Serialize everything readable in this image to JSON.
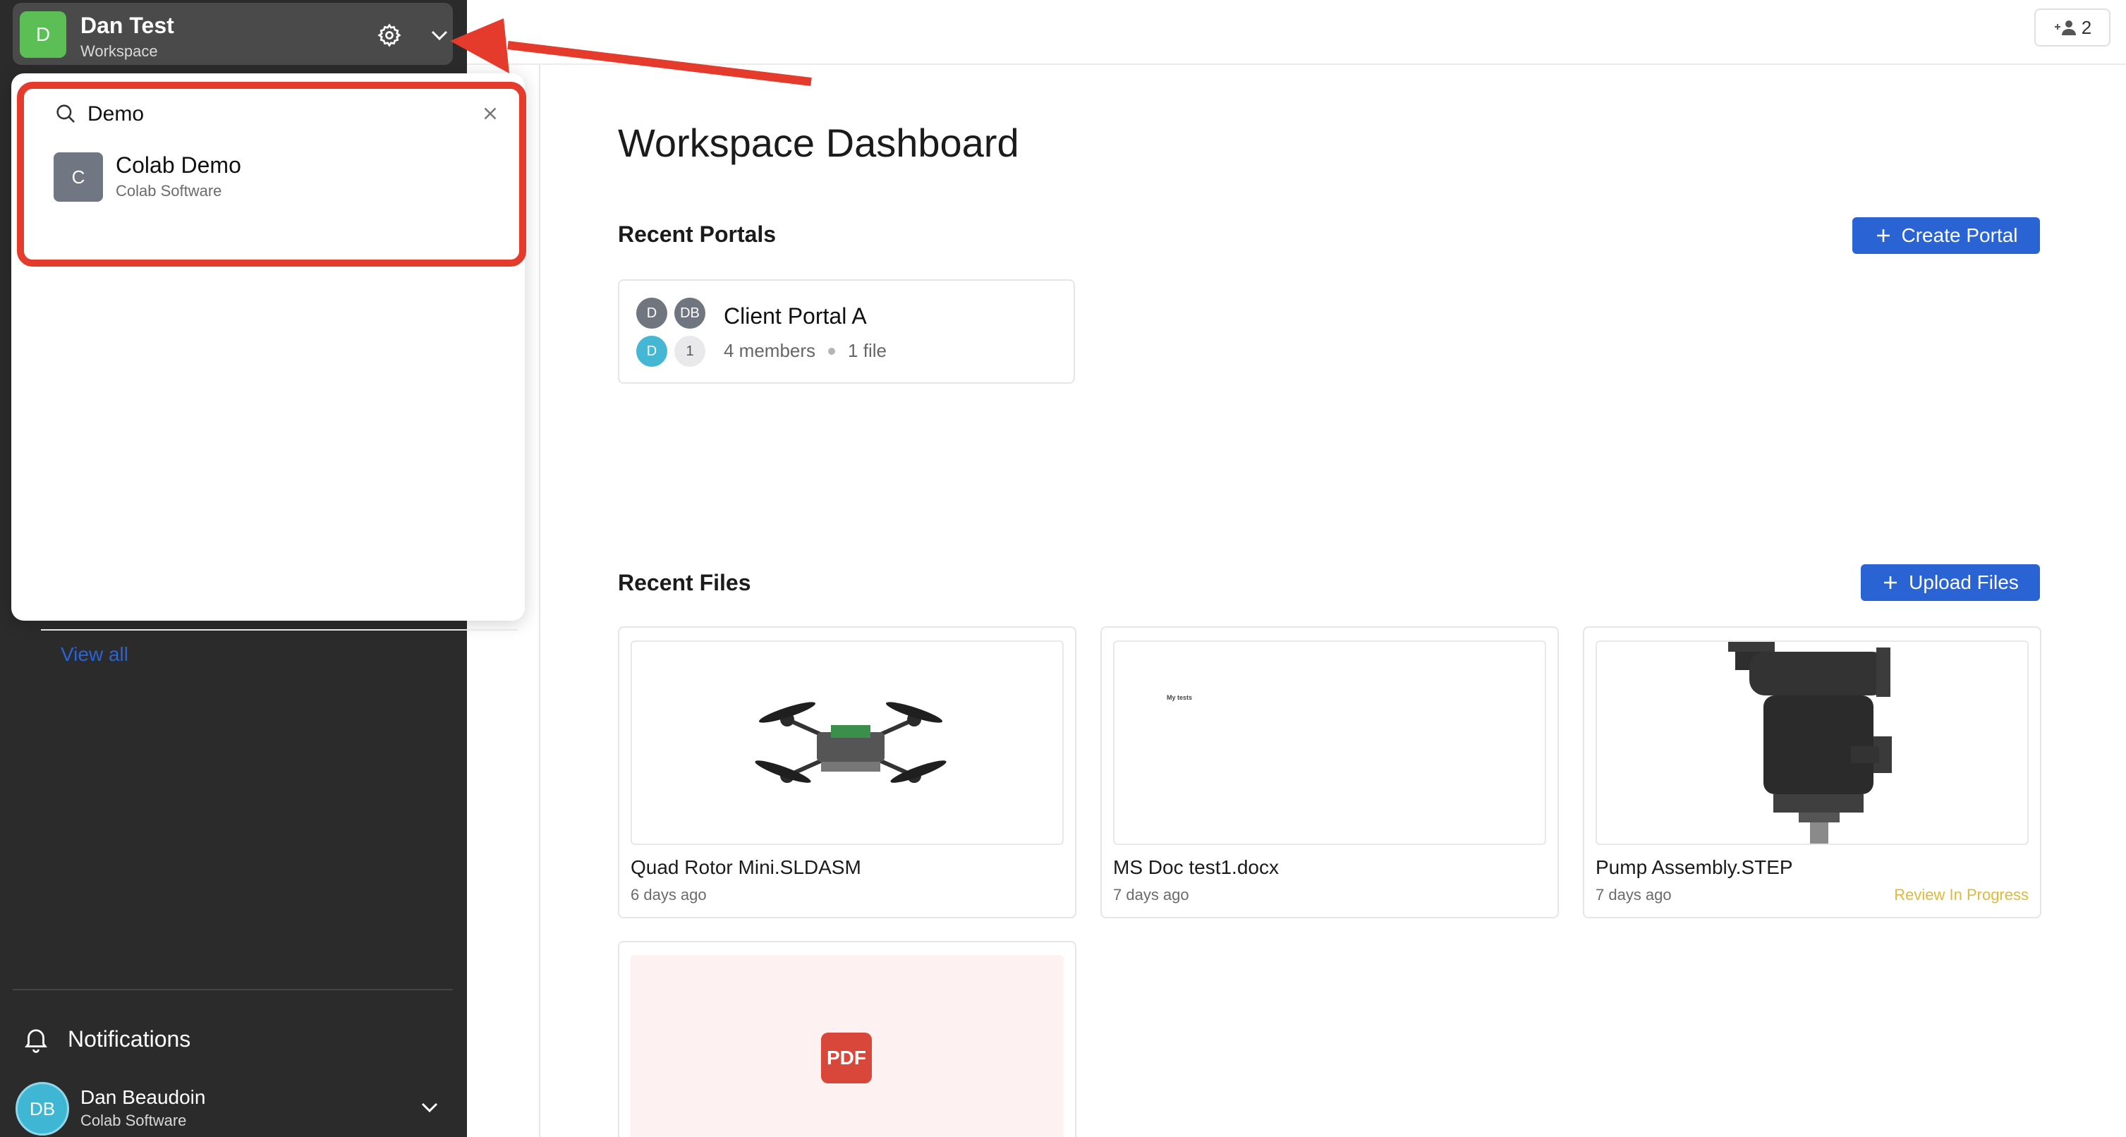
{
  "workspace": {
    "avatar_letter": "D",
    "name": "Dan Test",
    "subtitle": "Workspace",
    "avatar_color": "#5cbf55"
  },
  "dropdown": {
    "search_value": "Demo",
    "results": [
      {
        "avatar_letter": "C",
        "name": "Colab Demo",
        "subtitle": "Colab Software"
      }
    ],
    "view_all_label": "View all"
  },
  "sidebar": {
    "notifications_label": "Notifications",
    "user": {
      "initials": "DB",
      "name": "Dan Beaudoin",
      "org": "Colab Software"
    }
  },
  "topbar": {
    "members_count": "2"
  },
  "main": {
    "title": "Workspace Dashboard",
    "recent_portals": {
      "title": "Recent Portals",
      "create_label": "Create Portal",
      "portals": [
        {
          "name": "Client Portal A",
          "members": "4 members",
          "files": "1 file",
          "avatars": [
            "D",
            "DB",
            "D",
            "1"
          ]
        }
      ]
    },
    "recent_files": {
      "title": "Recent Files",
      "upload_label": "Upload Files",
      "files": [
        {
          "name": "Quad Rotor Mini.SLDASM",
          "date": "6 days ago",
          "status": ""
        },
        {
          "name": "MS Doc test1.docx",
          "date": "7 days ago",
          "status": "",
          "thumb_text": "My tests"
        },
        {
          "name": "Pump Assembly.STEP",
          "date": "7 days ago",
          "status": "Review In Progress"
        },
        {
          "name": "",
          "date": "",
          "status": "",
          "thumb_label": "PDF"
        }
      ]
    }
  },
  "colors": {
    "accent": "#2a63d4",
    "highlight": "#e53b2c",
    "status_review": "#e0b93a"
  }
}
